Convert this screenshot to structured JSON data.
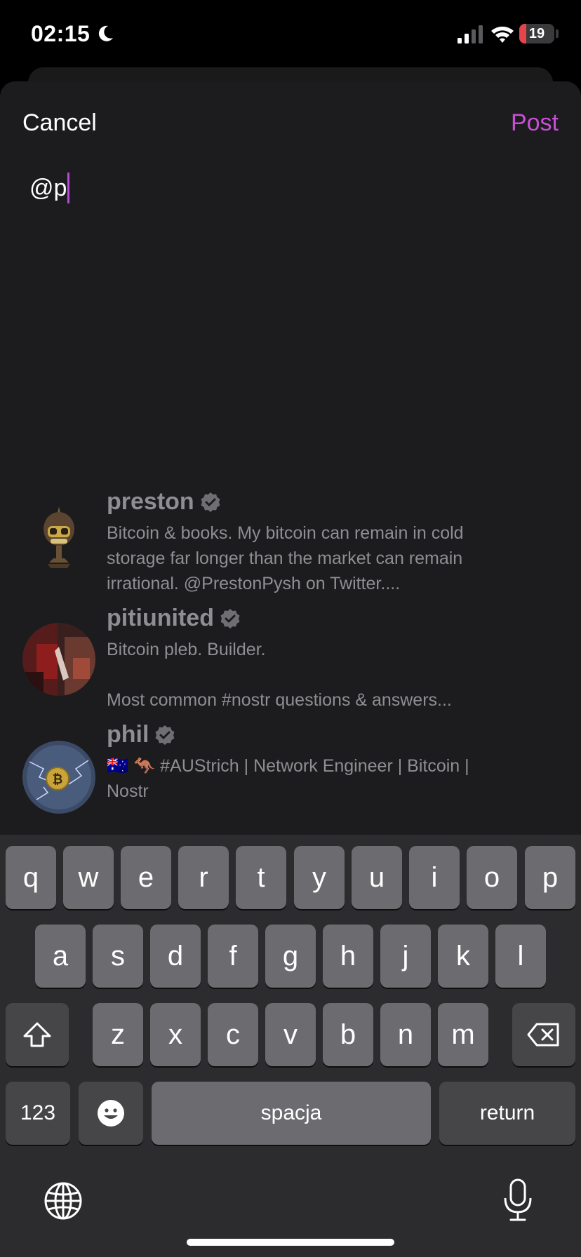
{
  "status_bar": {
    "time": "02:15",
    "battery": "19",
    "battery_level": 0.19
  },
  "header": {
    "cancel_label": "Cancel",
    "post_label": "Post"
  },
  "composer": {
    "text": "@p"
  },
  "suggestions": [
    {
      "name": "preston",
      "bio": "Bitcoin & books. My bitcoin can remain in cold storage far longer than the market can remain irrational. @PrestonPysh on Twitter...."
    },
    {
      "name": "pitiunited",
      "bio": "Bitcoin pleb. Builder.\n\nMost common #nostr questions & answers..."
    },
    {
      "name": "phil",
      "bio": "🇦🇺 🦘 #AUStrich | Network Engineer | Bitcoin | Nostr"
    }
  ],
  "keyboard": {
    "row1": [
      "q",
      "w",
      "e",
      "r",
      "t",
      "y",
      "u",
      "i",
      "o",
      "p"
    ],
    "row2": [
      "a",
      "s",
      "d",
      "f",
      "g",
      "h",
      "j",
      "k",
      "l"
    ],
    "row3": [
      "z",
      "x",
      "c",
      "v",
      "b",
      "n",
      "m"
    ],
    "numbers_label": "123",
    "space_label": "spacja",
    "return_label": "return"
  },
  "colors": {
    "accent": "#c94ed6",
    "sheet": "#1c1c1e",
    "keyboard": "#2c2c2e",
    "battery_low": "#e5454a"
  }
}
